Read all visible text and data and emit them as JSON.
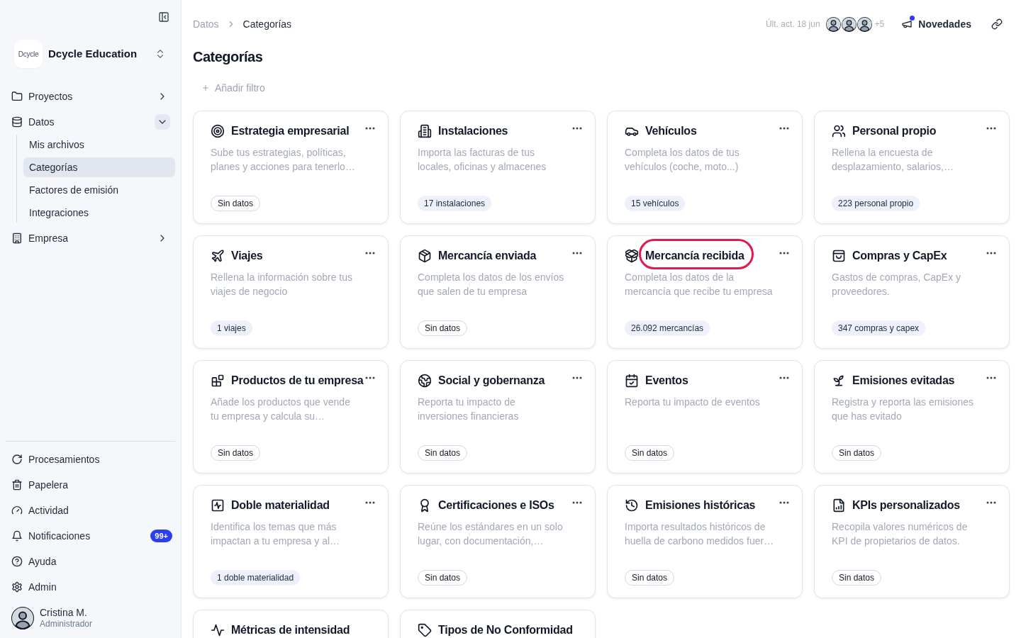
{
  "sidebar": {
    "organization": {
      "logo": "Dcycle",
      "name": "Dcycle Education"
    },
    "nav": [
      {
        "label": "Proyectos",
        "selected": false,
        "expanded": false
      },
      {
        "label": "Datos",
        "selected": false,
        "expanded": true,
        "children": [
          {
            "label": "Mis archivos",
            "selected": false
          },
          {
            "label": "Categorías",
            "selected": true
          },
          {
            "label": "Factores de emisión",
            "selected": false
          },
          {
            "label": "Integraciones",
            "selected": false
          }
        ]
      },
      {
        "label": "Empresa",
        "selected": false,
        "expanded": false
      }
    ],
    "footer_nav": [
      {
        "label": "Procesamientos",
        "selected": false
      },
      {
        "label": "Papelera",
        "selected": false
      },
      {
        "label": "Actividad",
        "selected": false
      },
      {
        "label": "Notificaciones",
        "selected": false,
        "badge": "99+"
      },
      {
        "label": "Ayuda",
        "selected": false
      },
      {
        "label": "Admin",
        "selected": false
      }
    ],
    "user": {
      "name": "Cristina M.",
      "role": "Administrador"
    }
  },
  "header": {
    "breadcrumb": [
      {
        "label": "Datos",
        "current": false
      },
      {
        "label": "Categorías",
        "current": true
      }
    ],
    "last_update": "Últ. act. 18 jun",
    "more_collaborators": "+5",
    "news": {
      "label": "Novedades",
      "unread": true
    }
  },
  "page": {
    "title": "Categorías",
    "add_filter": "Añadir filtro"
  },
  "cards": [
    {
      "title": "Estrategia empresarial",
      "description": "Sube tus estrategias, políticas, planes y acciones para tenerlo…",
      "badge": "Sin datos",
      "has_data": false,
      "menu": true,
      "highlighted": false
    },
    {
      "title": "Instalaciones",
      "description": "Importa las facturas de tus locales, oficinas y almacenes",
      "badge": "17 instalaciones",
      "has_data": true,
      "menu": true,
      "highlighted": false
    },
    {
      "title": "Vehículos",
      "description": "Completa los datos de tus vehículos (coche, moto...)",
      "badge": "15 vehículos",
      "has_data": true,
      "menu": true,
      "highlighted": false
    },
    {
      "title": "Personal propio",
      "description": "Rellena la encuesta de desplazamiento, salarios,…",
      "badge": "223 personal propio",
      "has_data": true,
      "menu": true,
      "highlighted": false
    },
    {
      "title": "Viajes",
      "description": "Rellena la información sobre tus viajes de negocio",
      "badge": "1 viajes",
      "has_data": true,
      "menu": true,
      "highlighted": false
    },
    {
      "title": "Mercancía enviada",
      "description": "Completa los datos de los envíos que salen de tu empresa",
      "badge": "Sin datos",
      "has_data": false,
      "menu": true,
      "highlighted": false
    },
    {
      "title": "Mercancía recibida",
      "description": "Completa los datos de la mercancía que recibe tu empresa",
      "badge": "26.092 mercancías",
      "has_data": true,
      "menu": true,
      "highlighted": true
    },
    {
      "title": "Compras y CapEx",
      "description": "Gastos de compras, CapEx y proveedores.",
      "badge": "347 compras y capex",
      "has_data": true,
      "menu": true,
      "highlighted": false
    },
    {
      "title": "Productos de tu empresa",
      "description": "Añade los productos que vende tu empresa y calcula su…",
      "badge": "Sin datos",
      "has_data": false,
      "menu": true,
      "highlighted": false
    },
    {
      "title": "Social y gobernanza",
      "description": "Reporta tu impacto de inversiones financieras",
      "badge": "Sin datos",
      "has_data": false,
      "menu": true,
      "highlighted": false
    },
    {
      "title": "Eventos",
      "description": "Reporta tu impacto de eventos",
      "badge": "Sin datos",
      "has_data": false,
      "menu": true,
      "highlighted": false
    },
    {
      "title": "Emisiones evitadas",
      "description": "Registra y reporta las emisiones que has evitado",
      "badge": "Sin datos",
      "has_data": false,
      "menu": true,
      "highlighted": false
    },
    {
      "title": "Doble materialidad",
      "description": "Identifica los temas que más impactan a tu empresa y al…",
      "badge": "1 doble materialidad",
      "has_data": true,
      "menu": true,
      "highlighted": false
    },
    {
      "title": "Certificaciones e ISOs",
      "description": "Reúne los estándares en un solo lugar, con documentación,…",
      "badge": "Sin datos",
      "has_data": false,
      "menu": true,
      "highlighted": false
    },
    {
      "title": "Emisiones históricas",
      "description": "Importa resultados históricos de huella de carbono medidos fuer…",
      "badge": "Sin datos",
      "has_data": false,
      "menu": true,
      "highlighted": false
    },
    {
      "title": "KPIs personalizados",
      "description": "Recopila valores numéricos de KPI de propietarios de datos.",
      "badge": "Sin datos",
      "has_data": false,
      "menu": true,
      "highlighted": false
    },
    {
      "title": "Métricas de intensidad",
      "menu": false,
      "highlighted": false
    },
    {
      "title": "Tipos de No Conformidad",
      "menu": false,
      "highlighted": false
    }
  ]
}
